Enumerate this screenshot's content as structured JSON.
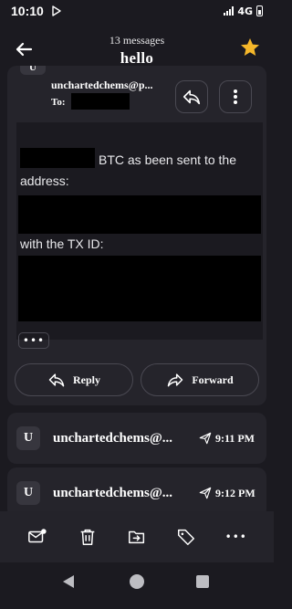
{
  "status_bar": {
    "time": "10:10",
    "network": "4G",
    "battery_label": "battery"
  },
  "header": {
    "subtitle": "13 messages",
    "title": "hello",
    "star_color": "#f5b72a"
  },
  "message": {
    "avatar_letter": "U",
    "sender": "unchartedchems@p...",
    "to_label": "To: ",
    "body": {
      "line1": "BTC as been sent to the",
      "line2": "address:",
      "line3": "with the TX ID:"
    },
    "more_label": "•••",
    "reply_label": "Reply",
    "forward_label": "Forward"
  },
  "collapsed_messages": [
    {
      "avatar_letter": "U",
      "sender": "unchartedchems@...",
      "time": "9:11 PM"
    },
    {
      "avatar_letter": "U",
      "sender": "unchartedchems@...",
      "time": "9:12 PM"
    }
  ],
  "toolbar": {
    "icons": [
      "mark-unread-icon",
      "trash-icon",
      "move-icon",
      "label-icon",
      "more-icon"
    ],
    "more_label": "•••"
  },
  "colors": {
    "background": "#1b1a20",
    "card": "#25242b",
    "border": "#4a4952",
    "accent_star": "#f5b72a"
  }
}
